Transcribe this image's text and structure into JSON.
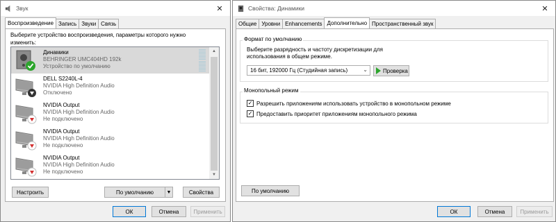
{
  "sound_window": {
    "title": "Звук",
    "tabs": [
      {
        "label": "Воспроизведение",
        "active": true
      },
      {
        "label": "Запись",
        "active": false
      },
      {
        "label": "Звуки",
        "active": false
      },
      {
        "label": "Связь",
        "active": false
      }
    ],
    "instruction": "Выберите устройство воспроизведения, параметры которого нужно изменить:",
    "devices": [
      {
        "name": "Динамики",
        "model": "BEHRINGER UMC404HD 192k",
        "status": "Устройство по умолчанию",
        "icon": "speaker-icon",
        "badge": "default-check-icon",
        "selected": true
      },
      {
        "name": "DELL S2240L-4",
        "model": "NVIDIA High Definition Audio",
        "status": "Отключено",
        "icon": "monitor-icon",
        "badge": "disabled-arrow-icon",
        "selected": false
      },
      {
        "name": "NVIDIA Output",
        "model": "NVIDIA High Definition Audio",
        "status": "Не подключено",
        "icon": "monitor-icon",
        "badge": "not-connected-arrow-icon",
        "selected": false
      },
      {
        "name": "NVIDIA Output",
        "model": "NVIDIA High Definition Audio",
        "status": "Не подключено",
        "icon": "monitor-icon",
        "badge": "not-connected-arrow-icon",
        "selected": false
      },
      {
        "name": "NVIDIA Output",
        "model": "NVIDIA High Definition Audio",
        "status": "Не подключено",
        "icon": "monitor-icon",
        "badge": "not-connected-arrow-icon",
        "selected": false
      }
    ],
    "buttons": {
      "configure": "Настроить",
      "default": "По умолчанию",
      "properties": "Свойства",
      "ok": "ОК",
      "cancel": "Отмена",
      "apply": "Применить"
    }
  },
  "props_window": {
    "title": "Свойства: Динамики",
    "tabs": [
      {
        "label": "Общие",
        "active": false
      },
      {
        "label": "Уровни",
        "active": false
      },
      {
        "label": "Enhancements",
        "active": false
      },
      {
        "label": "Дополнительно",
        "active": true
      },
      {
        "label": "Пространственный звук",
        "active": false
      }
    ],
    "default_format": {
      "group_label": "Формат по умолчанию",
      "description_line1": "Выберите разрядность и частоту дискретизации для",
      "description_line2": "использования в общем режиме.",
      "selected_format": "16 бит, 192000 Гц (Студийная запись)",
      "test_button": "Проверка"
    },
    "exclusive_mode": {
      "group_label": "Монопольный режим",
      "option1": "Разрешить приложениям использовать устройство в монопольном режиме",
      "option1_checked": true,
      "option2": "Предоставить приоритет приложениям монопольного режима",
      "option2_checked": true
    },
    "buttons": {
      "restore_default": "По умолчанию",
      "ok": "ОК",
      "cancel": "Отмена",
      "apply": "Применить"
    }
  },
  "colors": {
    "accent": "#0078d7",
    "check_green": "#2ca52c",
    "error_red": "#d32f2f",
    "selection": "#d9d9d9"
  }
}
